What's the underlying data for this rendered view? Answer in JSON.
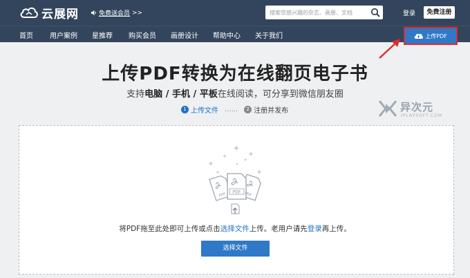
{
  "header": {
    "logo_text": "云展网",
    "promo_text": "免费送会员",
    "promo_arrow": ">>",
    "search_placeholder": "搜索您感兴趣的杂志、画册、文档",
    "login_label": "登录",
    "register_label": "免费注册"
  },
  "nav": {
    "items": [
      "首页",
      "用户案例",
      "星推荐",
      "购买会员",
      "画册设计",
      "帮助中心",
      "关于我们"
    ],
    "upload_label": "上传PDF"
  },
  "main": {
    "headline": "上传PDF转换为在线翻页电子书",
    "sub_prefix": "支持",
    "sub_b1": "电脑",
    "sub_sep1": " / ",
    "sub_b2": "手机",
    "sub_sep2": " / ",
    "sub_b3": "平板",
    "sub_suffix": "在线阅读，可分享到微信朋友圈",
    "step1_num": "1",
    "step1_label": "上传文件",
    "step_dots": "......",
    "step2_num": "2",
    "step2_label": "注册并发布"
  },
  "brand": {
    "name": "异次元",
    "url": "IPLAYSOFT.COM"
  },
  "dropzone": {
    "text_prefix": "将PDF拖至此处即可上传或点击",
    "link1": "选择文件",
    "text_middle": "上传。老用户请先",
    "link2": "登录",
    "text_suffix": "再上传。",
    "button_label": "选择文件",
    "file_badges": [
      "PDF",
      "PDF",
      "PDF"
    ]
  },
  "colors": {
    "header_bg": "#33455c",
    "accent_blue": "#2f79c8",
    "highlight_red": "#e02b2b"
  }
}
